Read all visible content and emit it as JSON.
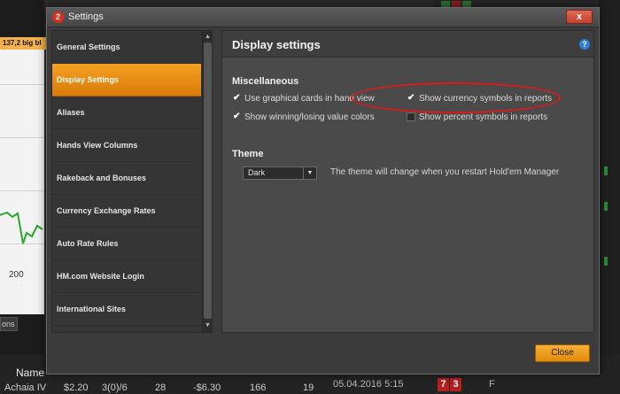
{
  "background": {
    "chart_tag": "137,2 big bl",
    "axis_label": "200",
    "tab_label": "ons",
    "table_header_name": "Name",
    "table_row": [
      "Achaia IV",
      "$2.20",
      "3(0)/6",
      "28",
      "-$6.30",
      "166",
      "19"
    ],
    "date": "05.04.2016 5:15",
    "badges": [
      "7",
      "3"
    ],
    "col_f": "F"
  },
  "dialog": {
    "app_icon": "hm2-logo-icon",
    "app_icon_glyph": "2",
    "title": "Settings",
    "close_glyph": "x"
  },
  "sidebar": {
    "items": [
      {
        "label": "General Settings",
        "active": false
      },
      {
        "label": "Display Settings",
        "active": true
      },
      {
        "label": "Aliases",
        "active": false
      },
      {
        "label": "Hands View Columns",
        "active": false
      },
      {
        "label": "Rakeback and Bonuses",
        "active": false
      },
      {
        "label": "Currency Exchange Rates",
        "active": false
      },
      {
        "label": "Auto Rate Rules",
        "active": false
      },
      {
        "label": "HM.com Website Login",
        "active": false
      },
      {
        "label": "International Sites",
        "active": false
      }
    ]
  },
  "panel": {
    "title": "Display settings",
    "help_glyph": "?",
    "miscellaneous": {
      "label": "Miscellaneous",
      "options": [
        {
          "label": "Use graphical cards in hand view",
          "checked": true
        },
        {
          "label": "Show winning/losing value colors",
          "checked": true
        },
        {
          "label": "Show currency symbols in reports",
          "checked": true
        },
        {
          "label": "Show percent symbols in reports",
          "checked": false
        }
      ]
    },
    "theme": {
      "label": "Theme",
      "value": "Dark",
      "note": "The theme will change when you restart Hold'em Manager"
    }
  },
  "footer": {
    "close_label": "Close"
  },
  "colors": {
    "accent": "#f0960f",
    "highlight_ring": "#e01818",
    "help": "#2f7fd8"
  }
}
